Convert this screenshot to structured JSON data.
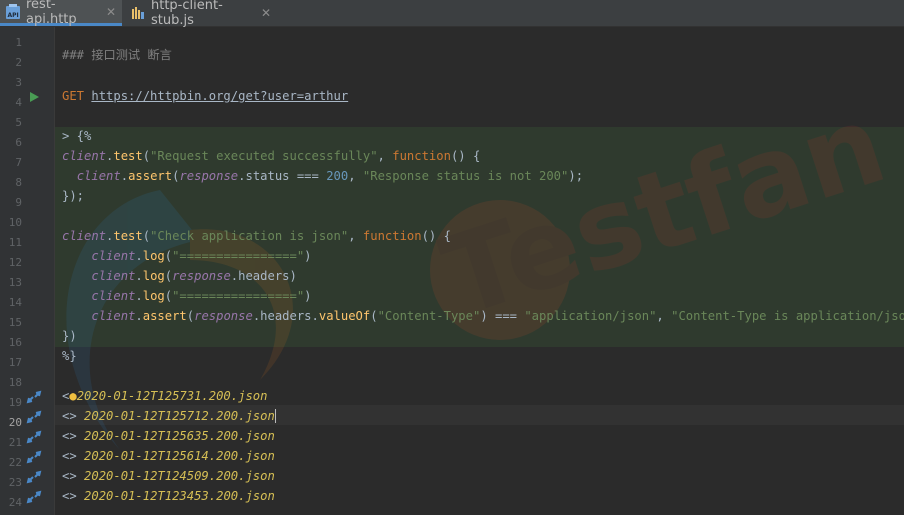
{
  "tabs": [
    {
      "label": "rest-api.http",
      "icon": "api-file-icon",
      "active": true
    },
    {
      "label": "http-client-stub.js",
      "icon": "js-stub-icon",
      "active": false
    }
  ],
  "lines": {
    "l2": "### 接口测试 断言",
    "l4_method": "GET",
    "l4_url": "https://httpbin.org/get?user=arthur",
    "l6": "> {%",
    "l7": {
      "v": "client",
      "dot": ".",
      "f": "test",
      "p1": "(",
      "s": "\"Request executed successfully\"",
      "c": ", ",
      "k": "function",
      "e": "() {"
    },
    "l8": {
      "v": "client",
      "f": "assert",
      "v2": "response",
      "p": ".status === ",
      "n": "200",
      "c": ", ",
      "s": "\"Response status is not 200\"",
      "e": ");"
    },
    "l9": "});",
    "l11": {
      "v": "client",
      "f": "test",
      "s": "\"Check application is json\"",
      "k": "function",
      "e": "() {"
    },
    "l12": {
      "v": "client",
      "f": "log",
      "s": "\"================\"",
      "e": ")"
    },
    "l13": {
      "v": "client",
      "f": "log",
      "v2": "response",
      "p": ".headers",
      "e": ")"
    },
    "l14": {
      "v": "client",
      "f": "log",
      "s": "\"================\"",
      "e": ")"
    },
    "l15": {
      "v": "client",
      "f": "assert",
      "v2": "response",
      "p": ".headers.",
      "f2": "valueOf",
      "s": "\"Content-Type\"",
      "m": ") === ",
      "s2": "\"application/json\"",
      "c": ", ",
      "s3": "\"Content-Type is application/json\"",
      "e": ")"
    },
    "l16": "})",
    "l17": "%}",
    "l19_prefix": "<",
    "l19": "2020-01-12T125731.200.json",
    "l20": "2020-01-12T125712.200.json",
    "l21": "2020-01-12T125635.200.json",
    "l22": "2020-01-12T125614.200.json",
    "l23": "2020-01-12T124509.200.json",
    "l24": "2020-01-12T123453.200.json",
    "resp_prefix": "<>"
  },
  "line_numbers": [
    "1",
    "2",
    "3",
    "4",
    "5",
    "6",
    "7",
    "8",
    "9",
    "10",
    "11",
    "12",
    "13",
    "14",
    "15",
    "16",
    "17",
    "18",
    "19",
    "20",
    "21",
    "22",
    "23",
    "24"
  ],
  "colors": {
    "accent": "#4a88c7",
    "run": "#499c54",
    "keyword": "#cc7832",
    "string": "#6a8759"
  }
}
